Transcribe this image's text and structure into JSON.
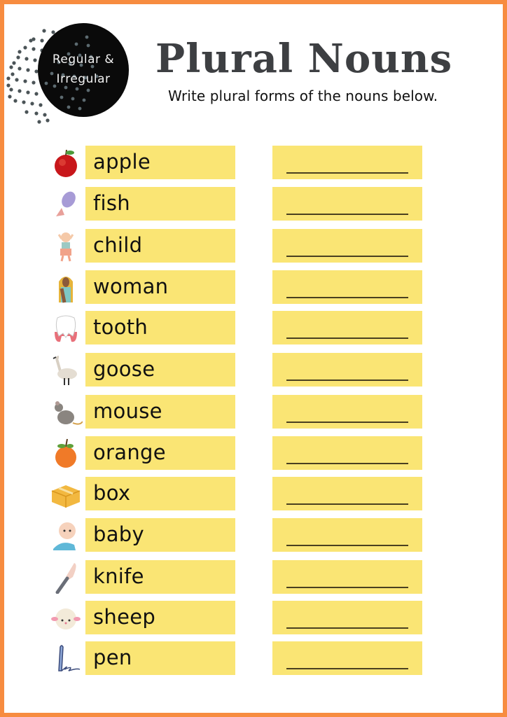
{
  "badge": {
    "line1": "Regular &",
    "line2": "Irregular",
    "background_color": "#0a0a0a"
  },
  "header": {
    "title": "Plural Nouns",
    "subtitle": "Write plural forms of the nouns below."
  },
  "colors": {
    "border": "#f78c40",
    "box": "#fae574",
    "title": "#3d3f42"
  },
  "items": [
    {
      "word": "apple",
      "icon": "apple-icon",
      "answer": ""
    },
    {
      "word": "fish",
      "icon": "fish-icon",
      "answer": ""
    },
    {
      "word": "child",
      "icon": "child-icon",
      "answer": ""
    },
    {
      "word": "woman",
      "icon": "woman-icon",
      "answer": ""
    },
    {
      "word": "tooth",
      "icon": "tooth-icon",
      "answer": ""
    },
    {
      "word": "goose",
      "icon": "goose-icon",
      "answer": ""
    },
    {
      "word": "mouse",
      "icon": "mouse-icon",
      "answer": ""
    },
    {
      "word": "orange",
      "icon": "orange-icon",
      "answer": ""
    },
    {
      "word": "box",
      "icon": "box-icon",
      "answer": ""
    },
    {
      "word": "baby",
      "icon": "baby-icon",
      "answer": ""
    },
    {
      "word": "knife",
      "icon": "knife-icon",
      "answer": ""
    },
    {
      "word": "sheep",
      "icon": "sheep-icon",
      "answer": ""
    },
    {
      "word": "pen",
      "icon": "pen-icon",
      "answer": ""
    }
  ]
}
